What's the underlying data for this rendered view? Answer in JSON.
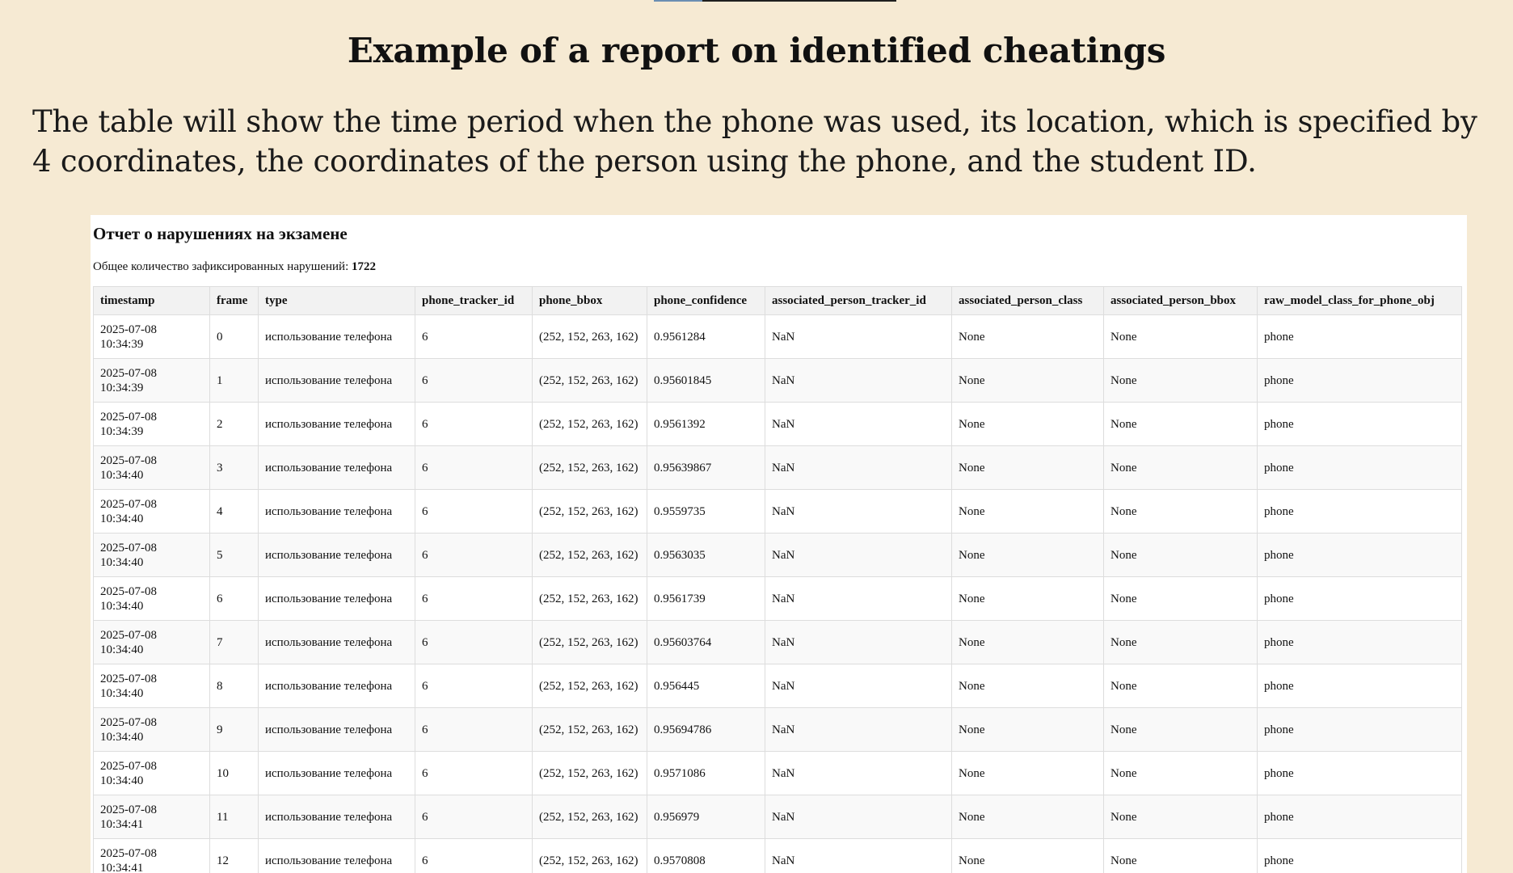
{
  "page": {
    "title": "Example of a report on identified cheatings",
    "intro": "The table will show the time period when the phone was used, its location, which is specified by 4 coordinates, the coordinates of the person using the phone, and the student ID."
  },
  "report": {
    "heading": "Отчет о нарушениях на экзамене",
    "summary_label": "Общее количество зафиксированных нарушений: ",
    "summary_count": "1722",
    "columns": [
      "timestamp",
      "frame",
      "type",
      "phone_tracker_id",
      "phone_bbox",
      "phone_confidence",
      "associated_person_tracker_id",
      "associated_person_class",
      "associated_person_bbox",
      "raw_model_class_for_phone_obj"
    ],
    "rows": [
      [
        "2025-07-08 10:34:39",
        "0",
        "использование телефона",
        "6",
        "(252, 152, 263, 162)",
        "0.9561284",
        "NaN",
        "None",
        "None",
        "phone"
      ],
      [
        "2025-07-08 10:34:39",
        "1",
        "использование телефона",
        "6",
        "(252, 152, 263, 162)",
        "0.95601845",
        "NaN",
        "None",
        "None",
        "phone"
      ],
      [
        "2025-07-08 10:34:39",
        "2",
        "использование телефона",
        "6",
        "(252, 152, 263, 162)",
        "0.9561392",
        "NaN",
        "None",
        "None",
        "phone"
      ],
      [
        "2025-07-08 10:34:40",
        "3",
        "использование телефона",
        "6",
        "(252, 152, 263, 162)",
        "0.95639867",
        "NaN",
        "None",
        "None",
        "phone"
      ],
      [
        "2025-07-08 10:34:40",
        "4",
        "использование телефона",
        "6",
        "(252, 152, 263, 162)",
        "0.9559735",
        "NaN",
        "None",
        "None",
        "phone"
      ],
      [
        "2025-07-08 10:34:40",
        "5",
        "использование телефона",
        "6",
        "(252, 152, 263, 162)",
        "0.9563035",
        "NaN",
        "None",
        "None",
        "phone"
      ],
      [
        "2025-07-08 10:34:40",
        "6",
        "использование телефона",
        "6",
        "(252, 152, 263, 162)",
        "0.9561739",
        "NaN",
        "None",
        "None",
        "phone"
      ],
      [
        "2025-07-08 10:34:40",
        "7",
        "использование телефона",
        "6",
        "(252, 152, 263, 162)",
        "0.95603764",
        "NaN",
        "None",
        "None",
        "phone"
      ],
      [
        "2025-07-08 10:34:40",
        "8",
        "использование телефона",
        "6",
        "(252, 152, 263, 162)",
        "0.956445",
        "NaN",
        "None",
        "None",
        "phone"
      ],
      [
        "2025-07-08 10:34:40",
        "9",
        "использование телефона",
        "6",
        "(252, 152, 263, 162)",
        "0.95694786",
        "NaN",
        "None",
        "None",
        "phone"
      ],
      [
        "2025-07-08 10:34:40",
        "10",
        "использование телефона",
        "6",
        "(252, 152, 263, 162)",
        "0.9571086",
        "NaN",
        "None",
        "None",
        "phone"
      ],
      [
        "2025-07-08 10:34:41",
        "11",
        "использование телефона",
        "6",
        "(252, 152, 263, 162)",
        "0.956979",
        "NaN",
        "None",
        "None",
        "phone"
      ],
      [
        "2025-07-08 10:34:41",
        "12",
        "использование телефона",
        "6",
        "(252, 152, 263, 162)",
        "0.9570808",
        "NaN",
        "None",
        "None",
        "phone"
      ]
    ]
  },
  "colors": {
    "page_background": "#f6ead3",
    "panel_background": "#ffffff",
    "header_background": "#f2f2f2",
    "stripe_background": "#f9f9f9",
    "border": "#dddddd"
  }
}
